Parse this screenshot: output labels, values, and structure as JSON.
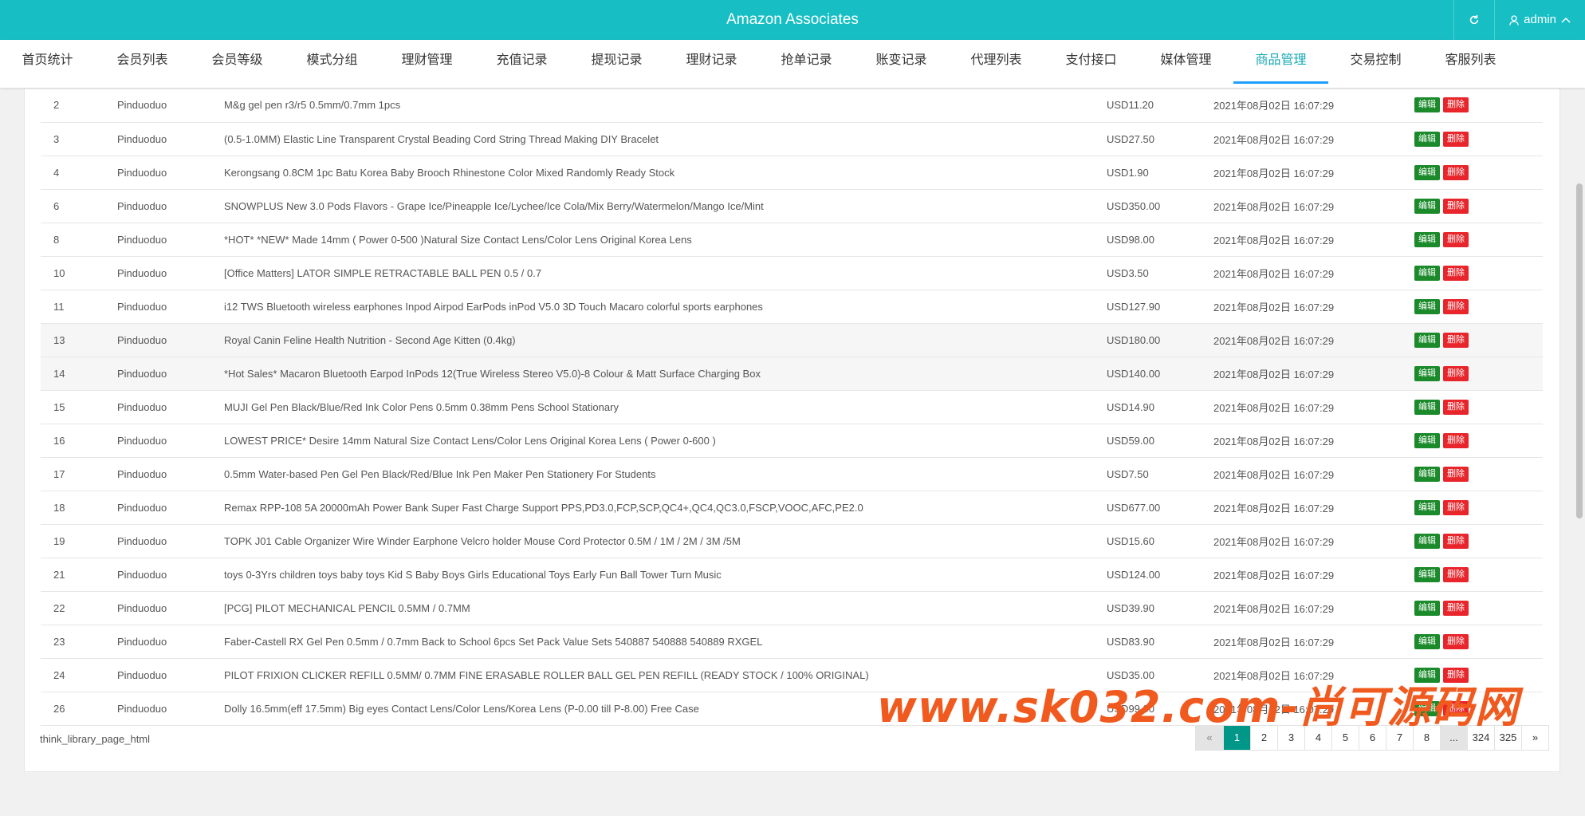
{
  "header": {
    "title": "Amazon Associates",
    "refresh_icon": "refresh-icon",
    "user_icon": "user-icon",
    "user_label": "admin"
  },
  "nav": [
    {
      "label": "首页统计"
    },
    {
      "label": "会员列表"
    },
    {
      "label": "会员等级"
    },
    {
      "label": "模式分组"
    },
    {
      "label": "理财管理"
    },
    {
      "label": "充值记录"
    },
    {
      "label": "提现记录"
    },
    {
      "label": "理财记录"
    },
    {
      "label": "抢单记录"
    },
    {
      "label": "账变记录"
    },
    {
      "label": "代理列表"
    },
    {
      "label": "支付接口"
    },
    {
      "label": "媒体管理"
    },
    {
      "label": "商品管理",
      "active": true
    },
    {
      "label": "交易控制"
    },
    {
      "label": "客服列表"
    }
  ],
  "table": {
    "edit_label": "编辑",
    "delete_label": "删除",
    "rows": [
      {
        "id": "2",
        "platform": "Pinduoduo",
        "name": "M&g gel pen r3/r5 0.5mm/0.7mm 1pcs",
        "price": "USD11.20",
        "time": "2021年08月02日 16:07:29"
      },
      {
        "id": "3",
        "platform": "Pinduoduo",
        "name": "(0.5-1.0MM) Elastic Line Transparent Crystal Beading Cord String Thread Making DIY Bracelet",
        "price": "USD27.50",
        "time": "2021年08月02日 16:07:29"
      },
      {
        "id": "4",
        "platform": "Pinduoduo",
        "name": "Kerongsang 0.8CM 1pc Batu Korea Baby Brooch Rhinestone Color Mixed Randomly Ready Stock",
        "price": "USD1.90",
        "time": "2021年08月02日 16:07:29"
      },
      {
        "id": "6",
        "platform": "Pinduoduo",
        "name": "SNOWPLUS New 3.0 Pods Flavors - Grape Ice/Pineapple Ice/Lychee/Ice Cola/Mix Berry/Watermelon/Mango Ice/Mint",
        "price": "USD350.00",
        "time": "2021年08月02日 16:07:29"
      },
      {
        "id": "8",
        "platform": "Pinduoduo",
        "name": "*HOT* *NEW* Made 14mm ( Power 0-500 )Natural Size Contact Lens/Color Lens Original Korea Lens",
        "price": "USD98.00",
        "time": "2021年08月02日 16:07:29"
      },
      {
        "id": "10",
        "platform": "Pinduoduo",
        "name": "[Office Matters] LATOR SIMPLE RETRACTABLE BALL PEN 0.5 / 0.7",
        "price": "USD3.50",
        "time": "2021年08月02日 16:07:29"
      },
      {
        "id": "11",
        "platform": "Pinduoduo",
        "name": "i12 TWS Bluetooth wireless earphones Inpod Airpod EarPods inPod V5.0 3D Touch Macaro colorful sports earphones",
        "price": "USD127.90",
        "time": "2021年08月02日 16:07:29"
      },
      {
        "id": "13",
        "platform": "Pinduoduo",
        "name": "Royal Canin Feline Health Nutrition - Second Age Kitten (0.4kg)",
        "price": "USD180.00",
        "time": "2021年08月02日 16:07:29",
        "hl": true
      },
      {
        "id": "14",
        "platform": "Pinduoduo",
        "name": "*Hot Sales* Macaron Bluetooth Earpod InPods 12(True Wireless Stereo V5.0)-8 Colour & Matt Surface Charging Box",
        "price": "USD140.00",
        "time": "2021年08月02日 16:07:29",
        "hl": true
      },
      {
        "id": "15",
        "platform": "Pinduoduo",
        "name": "MUJI Gel Pen Black/Blue/Red Ink Color Pens 0.5mm 0.38mm Pens School Stationary",
        "price": "USD14.90",
        "time": "2021年08月02日 16:07:29"
      },
      {
        "id": "16",
        "platform": "Pinduoduo",
        "name": "LOWEST PRICE* Desire 14mm Natural Size Contact Lens/Color Lens Original Korea Lens ( Power 0-600 )",
        "price": "USD59.00",
        "time": "2021年08月02日 16:07:29"
      },
      {
        "id": "17",
        "platform": "Pinduoduo",
        "name": "0.5mm Water-based Pen Gel Pen Black/Red/Blue Ink Pen Maker Pen Stationery For Students",
        "price": "USD7.50",
        "time": "2021年08月02日 16:07:29"
      },
      {
        "id": "18",
        "platform": "Pinduoduo",
        "name": "Remax RPP-108 5A 20000mAh Power Bank Super Fast Charge Support PPS,PD3.0,FCP,SCP,QC4+,QC4,QC3.0,FSCP,VOOC,AFC,PE2.0",
        "price": "USD677.00",
        "time": "2021年08月02日 16:07:29"
      },
      {
        "id": "19",
        "platform": "Pinduoduo",
        "name": "TOPK J01 Cable Organizer Wire Winder Earphone Velcro holder Mouse Cord Protector 0.5M / 1M / 2M / 3M /5M",
        "price": "USD15.60",
        "time": "2021年08月02日 16:07:29"
      },
      {
        "id": "21",
        "platform": "Pinduoduo",
        "name": "toys 0-3Yrs children toys baby toys Kid S Baby Boys Girls Educational Toys Early Fun Ball Tower Turn Music",
        "price": "USD124.00",
        "time": "2021年08月02日 16:07:29"
      },
      {
        "id": "22",
        "platform": "Pinduoduo",
        "name": "[PCG] PILOT MECHANICAL PENCIL 0.5MM / 0.7MM",
        "price": "USD39.90",
        "time": "2021年08月02日 16:07:29"
      },
      {
        "id": "23",
        "platform": "Pinduoduo",
        "name": "Faber-Castell RX Gel Pen 0.5mm / 0.7mm Back to School 6pcs Set Pack Value Sets 540887 540888 540889 RXGEL",
        "price": "USD83.90",
        "time": "2021年08月02日 16:07:29"
      },
      {
        "id": "24",
        "platform": "Pinduoduo",
        "name": "PILOT FRIXION CLICKER REFILL 0.5MM/ 0.7MM FINE ERASABLE ROLLER BALL GEL PEN REFILL (READY STOCK / 100% ORIGINAL)",
        "price": "USD35.00",
        "time": "2021年08月02日 16:07:29"
      },
      {
        "id": "26",
        "platform": "Pinduoduo",
        "name": "Dolly 16.5mm(eff 17.5mm) Big eyes Contact Lens/Color Lens/Korea Lens (P-0.00 till P-8.00) Free Case",
        "price": "USD99.00",
        "time": "2021年08月02日 16:07:29"
      }
    ]
  },
  "footer": {
    "left_text": "think_library_page_html"
  },
  "pagination": [
    {
      "label": "«",
      "state": "disabled"
    },
    {
      "label": "1",
      "state": "active"
    },
    {
      "label": "2"
    },
    {
      "label": "3"
    },
    {
      "label": "4"
    },
    {
      "label": "5"
    },
    {
      "label": "6"
    },
    {
      "label": "7"
    },
    {
      "label": "8"
    },
    {
      "label": "...",
      "state": "ellipsis"
    },
    {
      "label": "324"
    },
    {
      "label": "325"
    },
    {
      "label": "»"
    }
  ],
  "watermark": "www.sk032.com-尚可源码网"
}
